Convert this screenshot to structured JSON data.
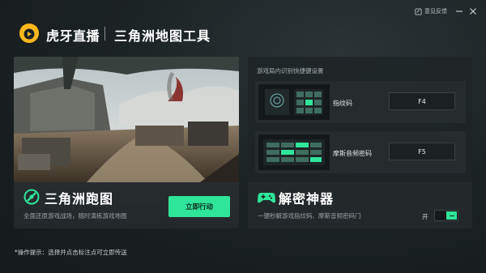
{
  "header": {
    "brand": "虎牙直播",
    "tool_title": "三角洲地图工具",
    "feedback_label": "意见反馈"
  },
  "map_run": {
    "title": "三角洲跑图",
    "description": "全面还原游戏战场，随时演练游戏地图",
    "action_label": "立即行动"
  },
  "hotkeys": {
    "section_title": "游戏局内识别快捷键设置",
    "items": [
      {
        "label": "指纹码",
        "key": "F4"
      },
      {
        "label": "摩斯音频密码",
        "key": "F5"
      }
    ]
  },
  "decrypt": {
    "title": "解密神器",
    "description": "一键秒解游戏指纹码、摩斯音频密码门",
    "toggle_label": "开",
    "toggle_on": true
  },
  "hint": "*操作提示：选择并点击标注点可立即传送",
  "colors": {
    "accent": "#2fe59a",
    "brand_yellow": "#ffb81c"
  }
}
